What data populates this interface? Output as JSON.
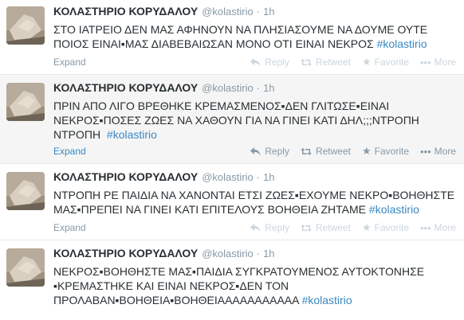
{
  "account": {
    "fullname": "ΚΟΛΑΣΤΗΡΙΟ ΚΟΡΥΔΑΛΟΥ",
    "username": "@kolastirio"
  },
  "actions": {
    "expand": "Expand",
    "reply": "Reply",
    "retweet": "Retweet",
    "favorite": "Favorite",
    "more": "More"
  },
  "icons": {
    "reply": "reply-arrow-icon",
    "retweet": "retweet-icon",
    "favorite": "star-icon",
    "more": "ellipsis-icon"
  },
  "colors": {
    "hashtag": "#3b88c3",
    "hover_background": "#f5f5f5",
    "meta_text": "#8899a6"
  },
  "tweets": [
    {
      "time": "1h",
      "lines": [
        "ΣΤΟ ΙΑΤΡΕΙΟ ΔΕΝ ΜΑΣ ΑΦΗΝΟΥΝ ΝΑ ΠΛΗΣΙΑΣΟΥΜΕ ΝΑ ΔΟΥΜΕ ΟΥΤΕ",
        "ΠΟΙΟΣ ΕΙΝΑΙ▪ΜΑΣ ΔΙΑΒΕΒΑΙΩΣΑΝ ΜΟΝΟ ΟΤΙ ΕΙΝΑΙ ΝΕΚΡΟΣ"
      ],
      "hashtag": "#kolastirio"
    },
    {
      "time": "1h",
      "lines": [
        "ΠΡΙΝ ΑΠΟ ΛΙΓΟ ΒΡΕΘΗΚΕ ΚΡΕΜΑΣΜΕΝΟΣ▪ΔΕΝ ΓΛΙΤΩΣΕ▪ΕΙΝΑΙ",
        "ΝΕΚΡΟΣ▪ΠΟΣΕΣ ΖΩΕΣ ΝΑ ΧΑΘΟΥΝ ΓΙΑ ΝΑ ΓΙΝΕΙ ΚΑΤΙ ΔΗΛ;;;ΝΤΡΟΠΗ",
        "ΝΤΡΟΠΗ"
      ],
      "hashtag": "#kolastirio"
    },
    {
      "time": "1h",
      "lines": [
        "ΝΤΡΟΠΗ ΡΕ ΠΑΙΔΙΑ ΝΑ ΧΑΝΟΝΤΑΙ ΕΤΣΙ ΖΩΕΣ▪ΕΧΟΥΜΕ ΝΕΚΡΟ▪ΒΟΗΘΗΣΤΕ",
        "ΜΑΣ▪ΠΡΕΠΕΙ ΝΑ ΓΙΝΕΙ ΚΑΤΙ ΕΠΙΤΕΛΟΥΣ ΒΟΗΘΕΙΑ ΖΗΤΑΜΕ"
      ],
      "hashtag": "#kolastirio"
    },
    {
      "time": "1h",
      "lines": [
        "ΝΕΚΡΟΣ▪ΒΟΗΘΗΣΤΕ ΜΑΣ▪ΠΑΙΔΙΑ ΣΥΓΚΡΑΤΟΥΜΕΝΟΣ ΑΥΤΟΚΤΟΝΗΣΕ",
        "▪ΚΡΕΜΑΣΤΗΚΕ ΚΑΙ ΕΙΝΑΙ ΝΕΚΡΟΣ▪ΔΕΝ ΤΟΝ",
        "ΠΡΟΛΑΒΑΝ▪ΒΟΗΘΕΙΑ▪ΒΟΗΘΕΙΑΑΑΑΑΑΑΑΑΑΑ"
      ],
      "hashtag": "#kolastirio"
    }
  ]
}
